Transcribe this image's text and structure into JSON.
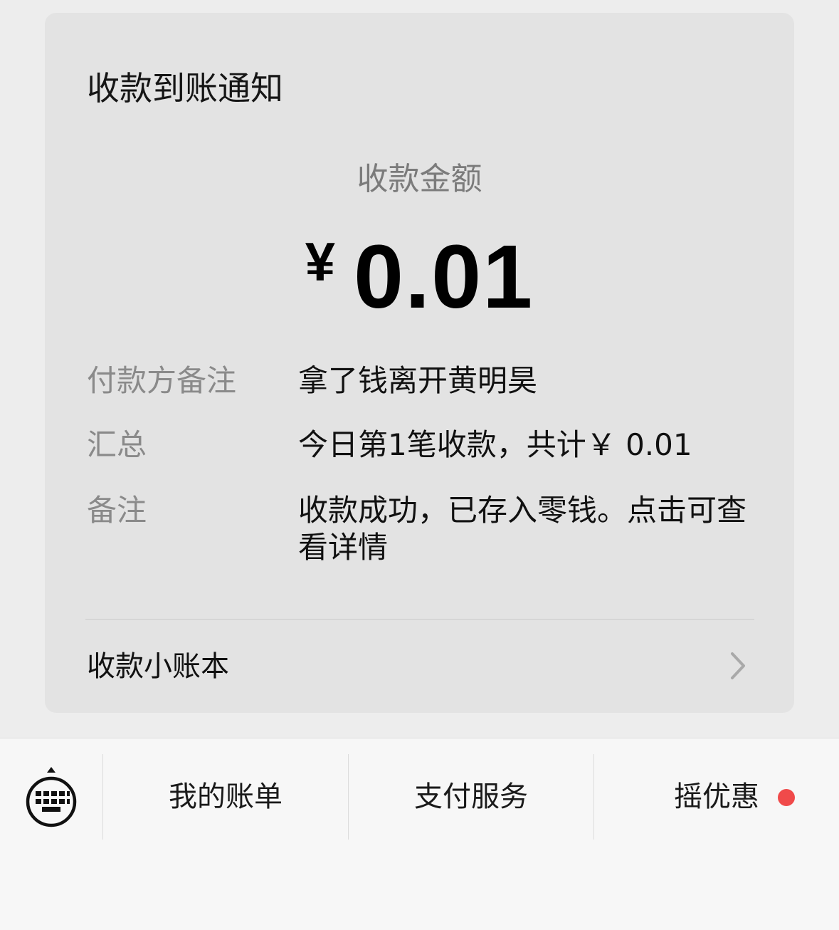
{
  "card": {
    "title": "收款到账通知",
    "amount_label": "收款金额",
    "currency_symbol": "¥",
    "amount": "0.01",
    "rows": [
      {
        "key": "付款方备注",
        "value": "拿了钱离开黄明昊"
      },
      {
        "key": "汇总",
        "value": "今日第1笔收款，共计￥ 0.01"
      },
      {
        "key": "备注",
        "value": "收款成功，已存入零钱。点击可查看详情"
      }
    ],
    "ledger_label": "收款小账本",
    "ledger_icon": "chevron-right-icon"
  },
  "bottom_bar": {
    "keyboard_icon": "keyboard-toggle-icon",
    "menu": [
      {
        "label": "我的账单"
      },
      {
        "label": "支付服务"
      },
      {
        "label": "摇优惠",
        "badge": "red-dot"
      }
    ]
  },
  "colors": {
    "background": "#ededed",
    "card": "#e3e3e3",
    "badge": "#f04a4a",
    "muted_text": "#8a8a8a"
  }
}
